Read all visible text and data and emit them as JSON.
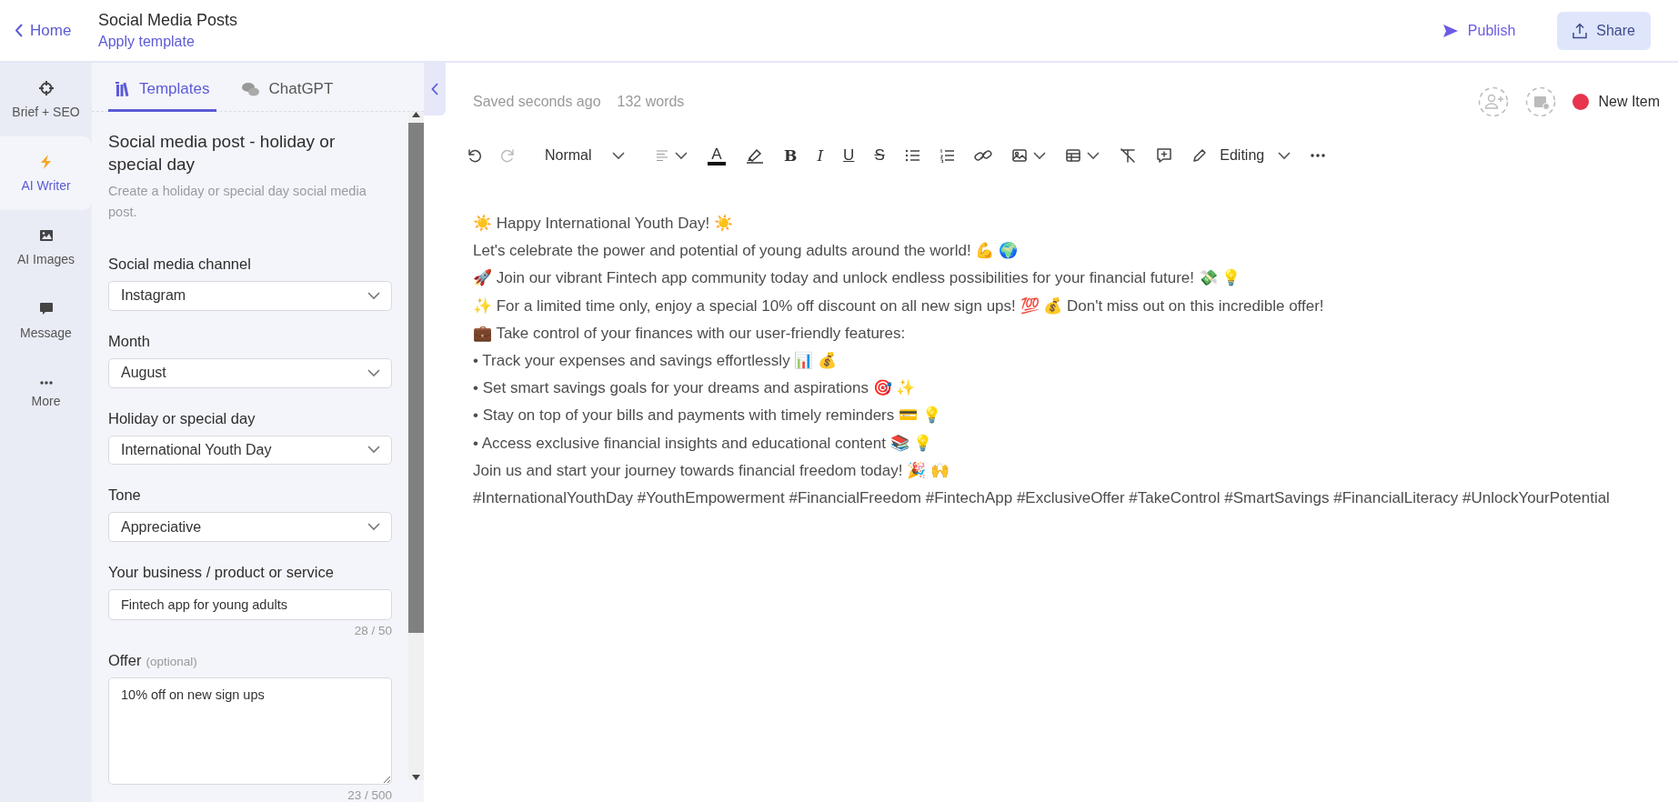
{
  "header": {
    "back_link": "Home",
    "title": "Social Media Posts",
    "subtitle_link": "Apply template",
    "actions": [
      {
        "label": "Publish",
        "kind": "link"
      },
      {
        "label": "Share",
        "kind": "button"
      }
    ]
  },
  "rail": {
    "items": [
      {
        "label": "Brief + SEO",
        "kind": "target",
        "selected": false
      },
      {
        "label": "AI Writer",
        "kind": "bolt",
        "selected": true
      },
      {
        "label": "AI Images",
        "kind": "image",
        "selected": false
      },
      {
        "label": "Message",
        "kind": "bubble",
        "selected": false
      },
      {
        "label": "More",
        "kind": "dots",
        "selected": false
      }
    ]
  },
  "panel": {
    "tabs": [
      {
        "label": "Templates",
        "kind": "books",
        "selected": true
      },
      {
        "label": "ChatGPT",
        "kind": "chats",
        "selected": false
      }
    ],
    "template": {
      "heading": "Social media post - holiday or special day",
      "description": "Create a holiday or special day social media post."
    },
    "fields": [
      {
        "kind": "select",
        "label": "Social media channel",
        "value": "Instagram"
      },
      {
        "kind": "select",
        "label": "Month",
        "value": "August"
      },
      {
        "kind": "select",
        "label": "Holiday or special day",
        "value": "International Youth Day"
      },
      {
        "kind": "select",
        "label": "Tone",
        "value": "Appreciative"
      },
      {
        "kind": "input",
        "label": "Your business / product or service",
        "value": "Fintech app for young adults",
        "counter": "28 / 50"
      },
      {
        "kind": "textarea",
        "label": "Offer",
        "hint": "(optional)",
        "value": "10% off on new sign ups",
        "counter": "23 / 500"
      }
    ]
  },
  "editor": {
    "saved": "Saved seconds ago",
    "word_count": "132 words",
    "status": {
      "label": "New Item",
      "color": "#e8344e"
    },
    "toolbar": [
      {
        "kind": "undo",
        "disabled": false
      },
      {
        "kind": "redo",
        "disabled": true
      },
      {
        "kind": "style",
        "label": "Normal",
        "disabled": false
      },
      {
        "kind": "align",
        "disabled": false
      },
      {
        "kind": "text-color",
        "label": "A",
        "disabled": false
      },
      {
        "kind": "highlight",
        "disabled": false
      },
      {
        "kind": "bold",
        "label": "B",
        "disabled": false
      },
      {
        "kind": "italic",
        "label": "I",
        "disabled": false
      },
      {
        "kind": "underline",
        "label": "U",
        "disabled": false
      },
      {
        "kind": "strike",
        "label": "S",
        "disabled": false
      },
      {
        "kind": "bullets",
        "disabled": false
      },
      {
        "kind": "numbers",
        "disabled": false
      },
      {
        "kind": "link",
        "disabled": false
      },
      {
        "kind": "image",
        "disabled": false
      },
      {
        "kind": "table",
        "disabled": false
      },
      {
        "kind": "clear",
        "disabled": false
      },
      {
        "kind": "comment",
        "disabled": false
      },
      {
        "kind": "mode",
        "label": "Editing",
        "disabled": false
      },
      {
        "kind": "more",
        "disabled": false
      }
    ],
    "lines": [
      "☀️ Happy International Youth Day! ☀️",
      "Let's celebrate the power and potential of young adults around the world! 💪 🌍",
      "🚀 Join our vibrant Fintech app community today and unlock endless possibilities for your financial future! 💸 💡",
      "✨ For a limited time only, enjoy a special 10% off discount on all new sign ups! 💯 💰 Don't miss out on this incredible offer!",
      "💼 Take control of your finances with our user-friendly features:",
      "• Track your expenses and savings effortlessly 📊 💰",
      "• Set smart savings goals for your dreams and aspirations 🎯 ✨",
      "• Stay on top of your bills and payments with timely reminders 💳 💡",
      "• Access exclusive financial insights and educational content 📚 💡",
      "Join us and start your journey towards financial freedom today! 🎉 🙌",
      "#InternationalYouthDay #YouthEmpowerment #FinancialFreedom #FintechApp #ExclusiveOffer #TakeControl #SmartSavings #FinancialLiteracy #UnlockYourPotential"
    ]
  }
}
